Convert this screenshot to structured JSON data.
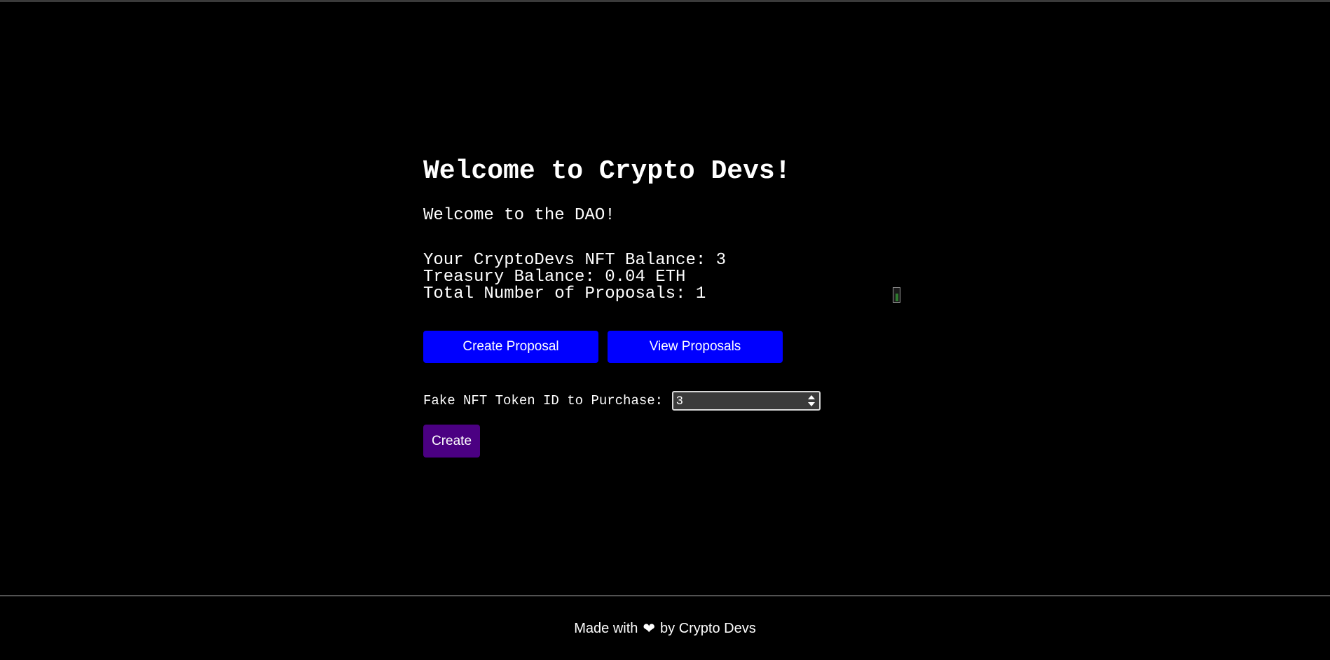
{
  "header": {
    "title": "Welcome to Crypto Devs!"
  },
  "main": {
    "welcome_text": "Welcome to the DAO!",
    "stats": {
      "nft_balance": "Your CryptoDevs NFT Balance: 3",
      "treasury_balance": "Treasury Balance: 0.04 ETH",
      "total_proposals": "Total Number of Proposals: 1"
    },
    "buttons": {
      "create_proposal": "Create Proposal",
      "view_proposals": "View Proposals"
    },
    "form": {
      "label": "Fake NFT Token ID to Purchase:",
      "token_id_value": "3",
      "create_button": "Create"
    }
  },
  "footer": {
    "made_with": "Made with",
    "heart": "❤",
    "by": "by Crypto Devs"
  },
  "icons": {
    "heart": "heart-icon",
    "spinner": "spinner-icon"
  },
  "colors": {
    "background": "#000000",
    "primary_button": "#0000ff",
    "create_button": "#4b0082",
    "text": "#ffffff"
  }
}
